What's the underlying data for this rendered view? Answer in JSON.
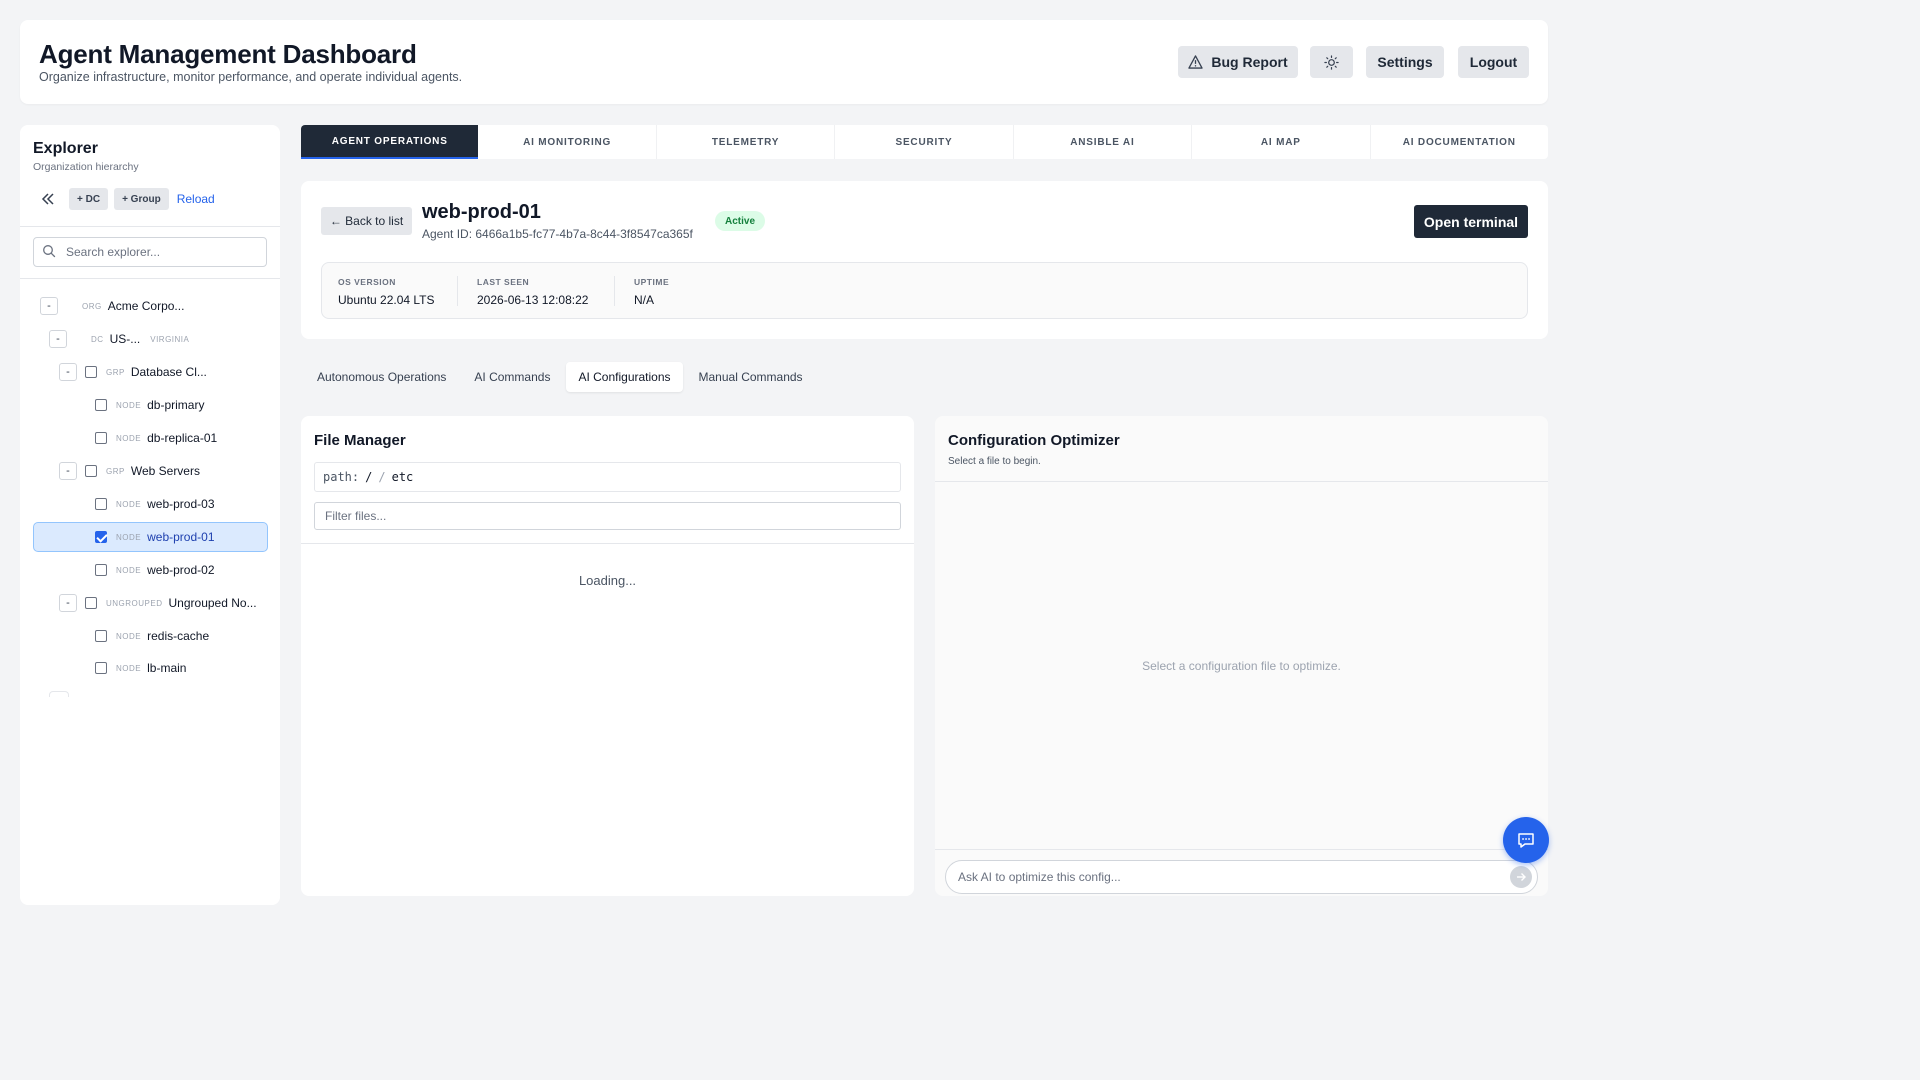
{
  "header": {
    "title": "Agent Management Dashboard",
    "subtitle": "Organize infrastructure, monitor performance, and operate individual agents.",
    "bug_report": "Bug Report",
    "settings": "Settings",
    "logout": "Logout"
  },
  "sidebar": {
    "title": "Explorer",
    "subtitle": "Organization hierarchy",
    "add_dc": "+ DC",
    "add_group": "+ Group",
    "reload": "Reload",
    "search_placeholder": "Search explorer...",
    "tree": [
      {
        "toggle": "-",
        "type": "ORG",
        "name": "Acme Corpo..."
      },
      {
        "toggle": "-",
        "type": "DC",
        "name": "US-...",
        "tag": "VIRGINIA"
      },
      {
        "toggle": "-",
        "type": "GRP",
        "name": "Database Cl..."
      },
      {
        "type": "NODE",
        "name": "db-primary"
      },
      {
        "type": "NODE",
        "name": "db-replica-01"
      },
      {
        "toggle": "-",
        "type": "GRP",
        "name": "Web Servers"
      },
      {
        "type": "NODE",
        "name": "web-prod-03"
      },
      {
        "type": "NODE",
        "name": "web-prod-01",
        "selected": true
      },
      {
        "type": "NODE",
        "name": "web-prod-02"
      },
      {
        "toggle": "-",
        "type": "UNGROUPED",
        "name": "Ungrouped No..."
      },
      {
        "type": "NODE",
        "name": "redis-cache"
      },
      {
        "type": "NODE",
        "name": "lb-main"
      }
    ]
  },
  "tabs": [
    "AGENT OPERATIONS",
    "AI MONITORING",
    "TELEMETRY",
    "SECURITY",
    "ANSIBLE AI",
    "AI MAP",
    "AI DOCUMENTATION"
  ],
  "agent": {
    "back": "← Back to list",
    "name": "web-prod-01",
    "id_text": "Agent ID: 6466a1b5-fc77-4b7a-8c44-3f8547ca365f",
    "status": "Active",
    "open_terminal": "Open terminal",
    "meta": [
      {
        "label": "OS VERSION",
        "value": "Ubuntu 22.04 LTS"
      },
      {
        "label": "LAST SEEN",
        "value": "2026-06-13 12:08:22"
      },
      {
        "label": "UPTIME",
        "value": "N/A"
      }
    ]
  },
  "subtabs": [
    "Autonomous Operations",
    "AI Commands",
    "AI Configurations",
    "Manual Commands"
  ],
  "file_manager": {
    "title": "File Manager",
    "path_label": "path:",
    "path_root": "/",
    "path_sep": "/",
    "path_dir": "etc",
    "filter_placeholder": "Filter files...",
    "loading": "Loading..."
  },
  "optimizer": {
    "title": "Configuration Optimizer",
    "subtitle": "Select a file to begin.",
    "empty": "Select a configuration file to optimize.",
    "ask_placeholder": "Ask AI to optimize this config..."
  },
  "colors": {
    "accent": "#2563eb",
    "dark": "#1f2937",
    "active_badge_bg": "#dcfce7",
    "active_badge_text": "#15803d"
  }
}
